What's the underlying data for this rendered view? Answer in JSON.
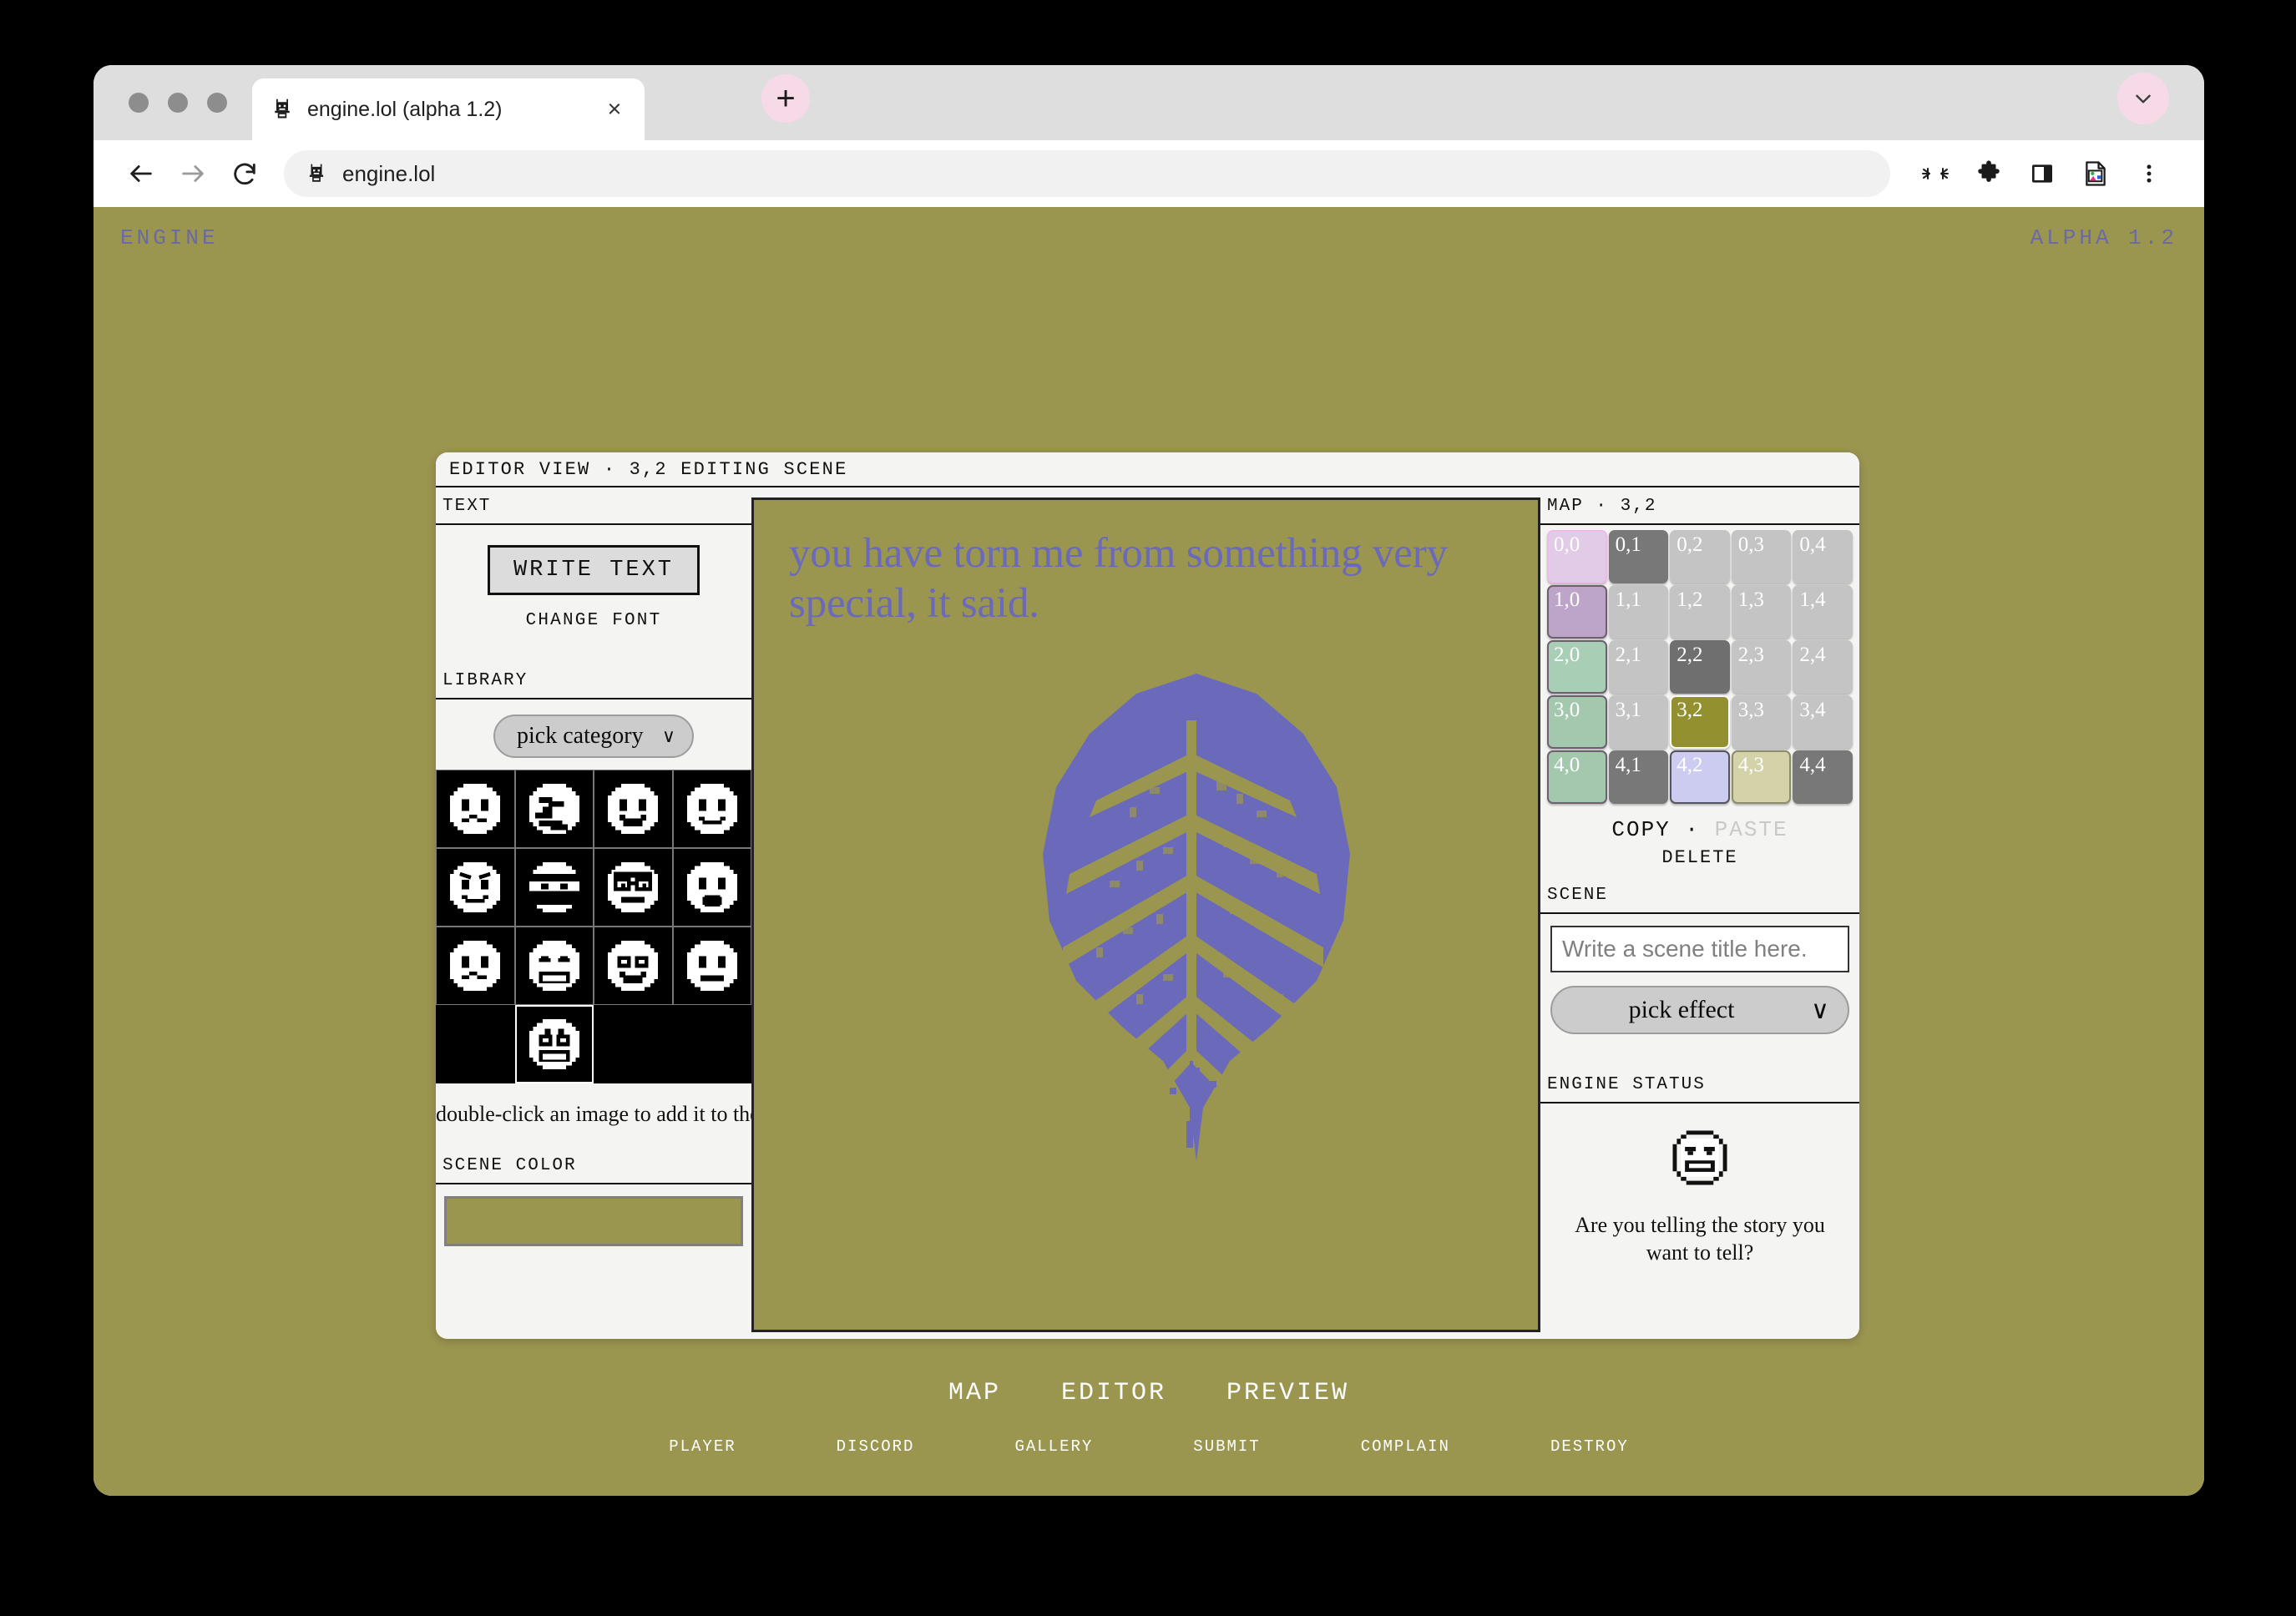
{
  "browser": {
    "tab_title": "engine.lol (alpha 1.2)",
    "tab_close_label": "×",
    "newtab_label": "+",
    "url": "engine.lol",
    "favicon_name": "engine-robot-favicon"
  },
  "page": {
    "brand": "ENGINE",
    "version": "ALPHA 1.2",
    "background_color": "#9a954f",
    "accent_color": "#6b6aba"
  },
  "app": {
    "titlebar": "EDITOR VIEW ·  3,2 EDITING SCENE",
    "left": {
      "text_label": "TEXT",
      "write_text_button": "WRITE TEXT",
      "change_font_link": "CHANGE FONT",
      "library_label": "LIBRARY",
      "category_select": {
        "value": "pick category",
        "chevron": "∨"
      },
      "library_items": [
        {
          "name": "worried-face",
          "selected": false
        },
        {
          "name": "distorted-face",
          "selected": false
        },
        {
          "name": "anxious-face",
          "selected": false
        },
        {
          "name": "frowning-face",
          "selected": false
        },
        {
          "name": "angry-face",
          "selected": false
        },
        {
          "name": "ninja-face",
          "selected": false
        },
        {
          "name": "nerd-face",
          "selected": false
        },
        {
          "name": "surprised-face",
          "selected": false
        },
        {
          "name": "confounded-face",
          "selected": false
        },
        {
          "name": "grinning-face",
          "selected": false
        },
        {
          "name": "shocked-face",
          "selected": false
        },
        {
          "name": "neutral-face",
          "selected": false
        },
        {
          "name": "blank-slot-1",
          "blank": true
        },
        {
          "name": "smiling-face",
          "selected": true
        },
        {
          "name": "blank-slot-2",
          "blank": true
        },
        {
          "name": "blank-slot-3",
          "blank": true
        }
      ],
      "hint": "double-click an image to add it to the scene.",
      "scene_color_label": "SCENE COLOR",
      "scene_color_value": "#9a954f"
    },
    "canvas": {
      "text": "you have torn me from something very special, it said.",
      "background_color": "#9a954f",
      "text_color": "#6b6aba",
      "artwork_name": "dithered-leaf"
    },
    "right": {
      "map_label": "MAP ·  3,2",
      "map_cells": [
        {
          "id": "0,0",
          "color": "#e2cbe6",
          "border": "#f0b9ec",
          "label_color": "#ffffff"
        },
        {
          "id": "0,1",
          "color": "#787878",
          "border": "transparent",
          "label_color": "#ffffff"
        },
        {
          "id": "0,2",
          "color": "#c4c4c4",
          "border": "transparent",
          "label_color": "#ffffff"
        },
        {
          "id": "0,3",
          "color": "#c4c4c4",
          "border": "transparent",
          "label_color": "#ffffff"
        },
        {
          "id": "0,4",
          "color": "#c4c4c4",
          "border": "transparent",
          "label_color": "#ffffff"
        },
        {
          "id": "1,0",
          "color": "#bda5c9",
          "border": "#6d6070",
          "label_color": "#ffffff"
        },
        {
          "id": "1,1",
          "color": "#c4c4c4",
          "border": "transparent",
          "label_color": "#ffffff"
        },
        {
          "id": "1,2",
          "color": "#c4c4c4",
          "border": "transparent",
          "label_color": "#ffffff"
        },
        {
          "id": "1,3",
          "color": "#c4c4c4",
          "border": "transparent",
          "label_color": "#ffffff"
        },
        {
          "id": "1,4",
          "color": "#c4c4c4",
          "border": "transparent",
          "label_color": "#ffffff"
        },
        {
          "id": "2,0",
          "color": "#a9ceb6",
          "border": "#6d6070",
          "label_color": "#ffffff"
        },
        {
          "id": "2,1",
          "color": "#c4c4c4",
          "border": "transparent",
          "label_color": "#ffffff"
        },
        {
          "id": "2,2",
          "color": "#6f6f6f",
          "border": "transparent",
          "label_color": "#ffffff"
        },
        {
          "id": "2,3",
          "color": "#c4c4c4",
          "border": "transparent",
          "label_color": "#ffffff"
        },
        {
          "id": "2,4",
          "color": "#c4c4c4",
          "border": "transparent",
          "label_color": "#ffffff"
        },
        {
          "id": "3,0",
          "color": "#a4c8ae",
          "border": "#6d6070",
          "label_color": "#ffffff"
        },
        {
          "id": "3,1",
          "color": "#c4c4c4",
          "border": "transparent",
          "label_color": "#ffffff"
        },
        {
          "id": "3,2",
          "color": "#93912f",
          "border": "#ffffff",
          "label_color": "#ffffff",
          "current": true
        },
        {
          "id": "3,3",
          "color": "#c4c4c4",
          "border": "transparent",
          "label_color": "#ffffff"
        },
        {
          "id": "3,4",
          "color": "#c4c4c4",
          "border": "transparent",
          "label_color": "#ffffff"
        },
        {
          "id": "4,0",
          "color": "#a4c8ae",
          "border": "#6d6070",
          "label_color": "#ffffff"
        },
        {
          "id": "4,1",
          "color": "#787878",
          "border": "transparent",
          "label_color": "#ffffff"
        },
        {
          "id": "4,2",
          "color": "#ccccf0",
          "border": "#55555f",
          "label_color": "#ffffff"
        },
        {
          "id": "4,3",
          "color": "#d4d2a8",
          "border": "#8d8c6c",
          "label_color": "#ffffff"
        },
        {
          "id": "4,4",
          "color": "#787878",
          "border": "transparent",
          "label_color": "#ffffff"
        }
      ],
      "copy_label": "COPY",
      "copy_separator": "·",
      "paste_label": "PASTE",
      "delete_label": "DELETE",
      "scene_label": "SCENE",
      "scene_title_placeholder": "Write a scene title here.",
      "scene_title_value": "",
      "effect_select": {
        "value": "pick effect",
        "chevron": "∨"
      },
      "engine_status_label": "ENGINE STATUS",
      "status_face_name": "grinning-pixel-face",
      "status_message": "Are you telling the story you want to tell?"
    }
  },
  "footer": {
    "main": [
      "MAP",
      "EDITOR",
      "PREVIEW"
    ],
    "sub": [
      "PLAYER",
      "DISCORD",
      "GALLERY",
      "SUBMIT",
      "COMPLAIN",
      "DESTROY"
    ]
  }
}
